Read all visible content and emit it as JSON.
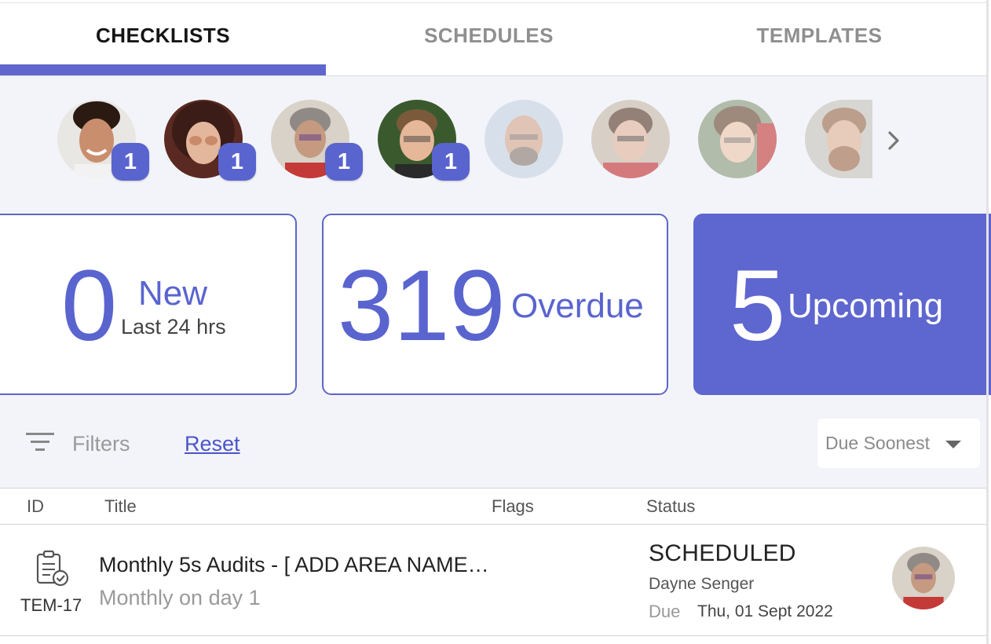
{
  "tabs": [
    {
      "label": "CHECKLISTS",
      "active": true
    },
    {
      "label": "SCHEDULES",
      "active": false
    },
    {
      "label": "TEMPLATES",
      "active": false
    }
  ],
  "users": [
    {
      "icon": "user-avatar",
      "count": "1"
    },
    {
      "icon": "user-avatar",
      "count": "1"
    },
    {
      "icon": "user-avatar",
      "count": "1"
    },
    {
      "icon": "user-avatar",
      "count": "1"
    },
    {
      "icon": "user-avatar"
    },
    {
      "icon": "user-avatar"
    },
    {
      "icon": "user-avatar"
    },
    {
      "icon": "user-avatar"
    }
  ],
  "stats": {
    "new": {
      "value": "0",
      "label": "New",
      "sub": "Last 24 hrs"
    },
    "overdue": {
      "value": "319",
      "label": "Overdue"
    },
    "upcoming": {
      "value": "5",
      "label": "Upcoming"
    }
  },
  "filters": {
    "label": "Filters",
    "reset": "Reset",
    "sort": "Due Soonest"
  },
  "table": {
    "headers": {
      "id": "ID",
      "title": "Title",
      "flags": "Flags",
      "status": "Status"
    },
    "rows": [
      {
        "id": "TEM-17",
        "title": "Monthly 5s Audits - [ ADD AREA NAME…",
        "subtitle": "Monthly on day 1",
        "status": "SCHEDULED",
        "assignee": "Dayne Senger",
        "due_label": "Due",
        "due_date": "Thu, 01 Sept 2022"
      }
    ]
  },
  "colors": {
    "accent": "#5e66cf",
    "badge": "#5a64cf",
    "link": "#4a55c8"
  }
}
